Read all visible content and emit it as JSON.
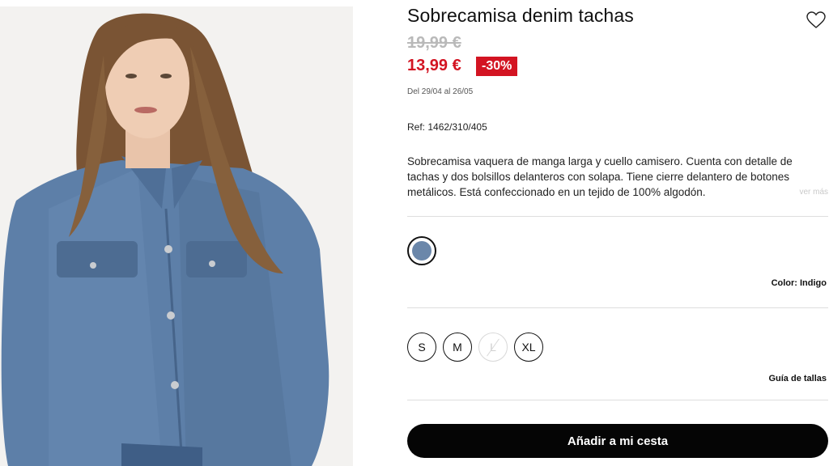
{
  "product": {
    "image_alt": "Sobrecamisa denim tachas",
    "title": "Sobrecamisa denim tachas",
    "old_price": "19,99 €",
    "new_price": "13,99 €",
    "discount": "-30%",
    "dates": "Del 29/04 al 26/05",
    "ref": "Ref: 1462/310/405",
    "description": "Sobrecamisa vaquera de manga larga y cuello camisero. Cuenta con detalle de tachas y dos bolsillos delanteros con solapa. Tiene cierre delantero de botones metálicos. Está confeccionado en un tejido de 100% algodón.",
    "ver_mas": "ver más"
  },
  "color": {
    "label": "Color: Indigo",
    "swatch_hex": "#6b87aa"
  },
  "sizes": [
    {
      "label": "S",
      "available": true
    },
    {
      "label": "M",
      "available": true
    },
    {
      "label": "L",
      "available": false
    },
    {
      "label": "XL",
      "available": true
    }
  ],
  "size_guide": "Guía de tallas",
  "add_to_cart": "Añadir a mi cesta",
  "icons": {
    "favorite": "heart-outline-icon"
  },
  "colors": {
    "sale_red": "#d31422",
    "button_black": "#050505",
    "old_price_grey": "#b9b9b9"
  }
}
